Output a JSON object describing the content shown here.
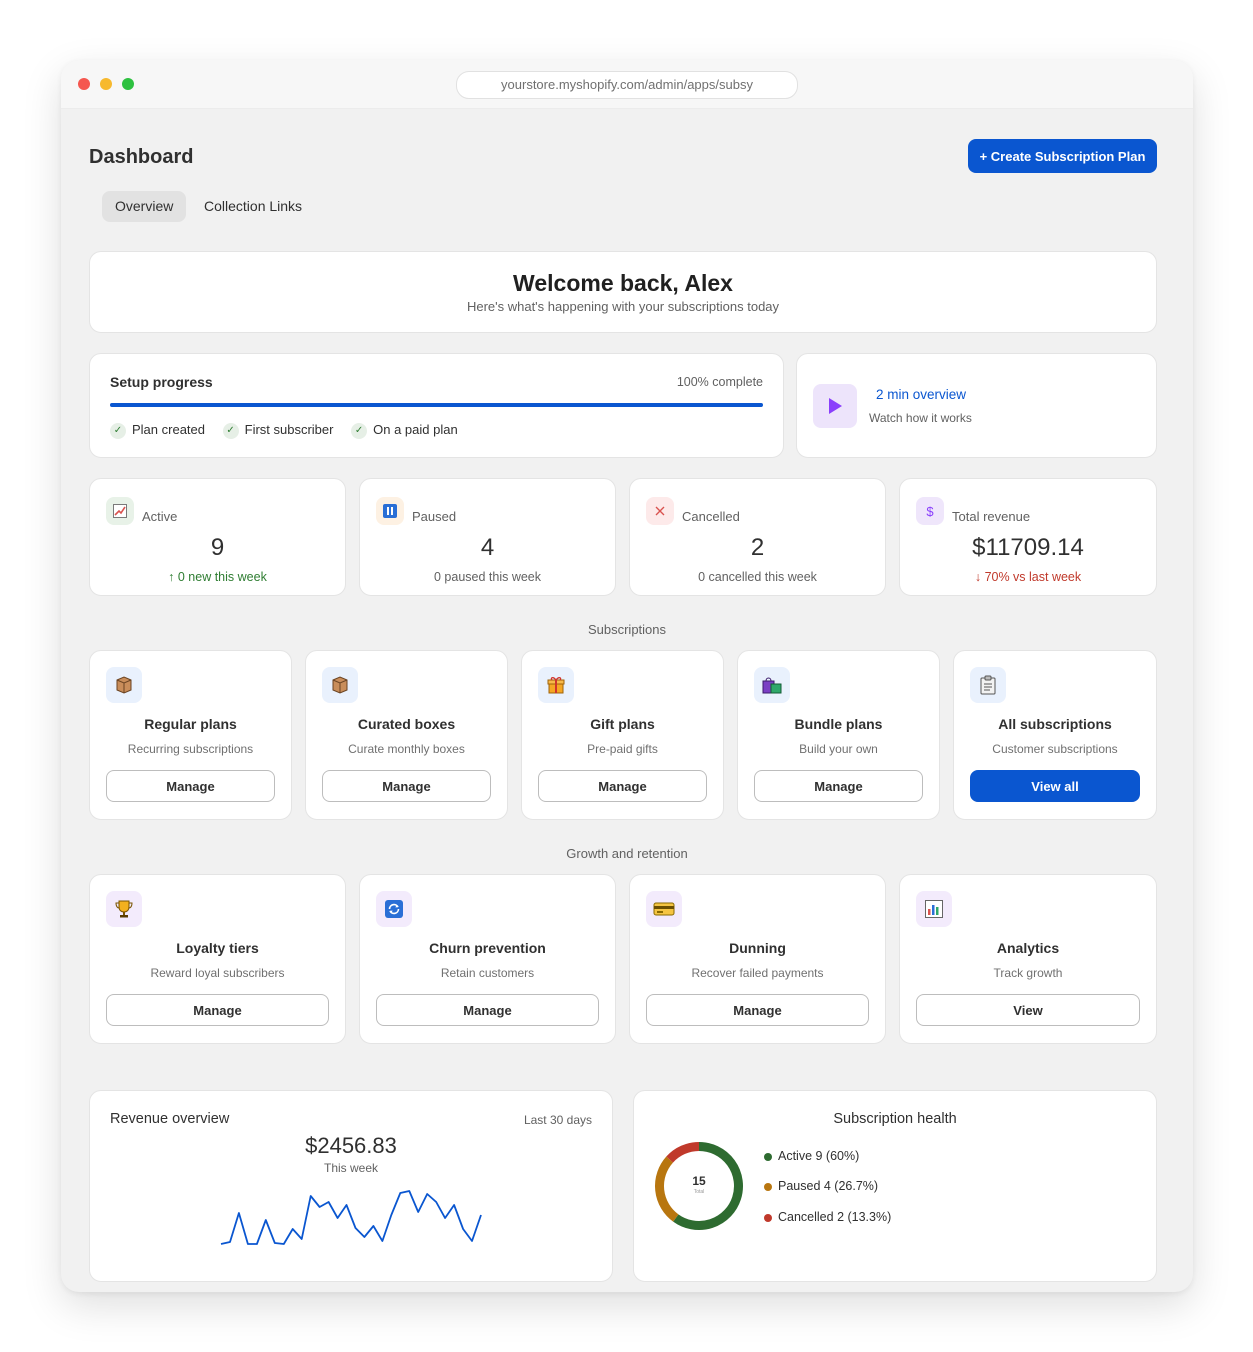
{
  "browser": {
    "url": "yourstore.myshopify.com/admin/apps/subsy"
  },
  "header": {
    "title": "Dashboard",
    "create_button": "+ Create Subscription Plan"
  },
  "tabs": [
    {
      "label": "Overview",
      "active": true
    },
    {
      "label": "Collection Links",
      "active": false
    }
  ],
  "welcome": {
    "title": "Welcome back, Alex",
    "subtitle": "Here's what's happening with your subscriptions today"
  },
  "setup": {
    "title": "Setup progress",
    "status": "100% complete",
    "progress": 1.0,
    "steps": [
      "Plan created",
      "First subscriber",
      "On a paid plan"
    ]
  },
  "video": {
    "title": "2 min overview",
    "subtitle": "Watch how it works"
  },
  "stats": [
    {
      "label": "Active",
      "value": "9",
      "sub": "↑ 0 new this week",
      "sub_color": "#2f7d32"
    },
    {
      "label": "Paused",
      "value": "4",
      "sub": "0 paused this week",
      "sub_color": "#616161"
    },
    {
      "label": "Cancelled",
      "value": "2",
      "sub": "0 cancelled this week",
      "sub_color": "#616161"
    },
    {
      "label": "Total revenue",
      "value": "$11709.14",
      "sub": "↓ 70% vs last week",
      "sub_color": "#c0392b"
    }
  ],
  "subscriptions": {
    "title": "Subscriptions",
    "cards": [
      {
        "title": "Regular plans",
        "sub": "Recurring subscriptions",
        "button": "Manage",
        "icon": "box-icon"
      },
      {
        "title": "Curated boxes",
        "sub": "Curate monthly boxes",
        "button": "Manage",
        "icon": "box-icon"
      },
      {
        "title": "Gift plans",
        "sub": "Pre-paid gifts",
        "button": "Manage",
        "icon": "gift-icon"
      },
      {
        "title": "Bundle plans",
        "sub": "Build your own",
        "button": "Manage",
        "icon": "shopping-bags-icon"
      },
      {
        "title": "All subscriptions",
        "sub": "Customer subscriptions",
        "button": "View all",
        "icon": "clipboard-icon"
      }
    ]
  },
  "growth": {
    "title": "Growth and retention",
    "cards": [
      {
        "title": "Loyalty tiers",
        "sub": "Reward loyal subscribers",
        "button": "Manage",
        "icon": "trophy-icon"
      },
      {
        "title": "Churn prevention",
        "sub": "Retain customers",
        "button": "Manage",
        "icon": "refresh-icon"
      },
      {
        "title": "Dunning",
        "sub": "Recover failed payments",
        "button": "Manage",
        "icon": "credit-card-icon"
      },
      {
        "title": "Analytics",
        "sub": "Track growth",
        "button": "View",
        "icon": "bar-chart-icon"
      }
    ]
  },
  "revenue": {
    "title": "Revenue overview",
    "period": "Last 30 days",
    "amount": "$2456.83",
    "amount_label": "This week"
  },
  "health": {
    "title": "Subscription health",
    "total": "15",
    "total_label": "Total",
    "legend": [
      "Active 9 (60%)",
      "Paused 4 (26.7%)",
      "Cancelled 2 (13.3%)"
    ]
  },
  "colors": {
    "accent": "#0a56d0",
    "active": "#2e6b30",
    "paused": "#b8760f",
    "cancelled": "#c0392b"
  },
  "chart_data": [
    {
      "type": "line",
      "x": [
        1,
        2,
        3,
        4,
        5,
        6,
        7,
        8,
        9,
        10,
        11,
        12,
        13,
        14,
        15,
        16,
        17,
        18,
        19,
        20,
        21,
        22,
        23,
        24,
        25,
        26,
        27,
        28,
        29,
        30
      ],
      "values": [
        5,
        7,
        36,
        5,
        5,
        29,
        6,
        5,
        20,
        10,
        53,
        42,
        47,
        31,
        44,
        21,
        12,
        23,
        8,
        34,
        56,
        58,
        37,
        55,
        47,
        31,
        44,
        20,
        8,
        34
      ],
      "series": [
        {
          "values": [
            5,
            7,
            36,
            5,
            5,
            29,
            6,
            5,
            20,
            10,
            53,
            42,
            47,
            31,
            44,
            21,
            12,
            23,
            8,
            34,
            56,
            58,
            37,
            55,
            47,
            31,
            44,
            20,
            8,
            34
          ]
        }
      ],
      "title": "",
      "xlabel": "",
      "ylabel": "",
      "ylim": [
        0,
        60
      ],
      "grid": false
    },
    {
      "type": "pie",
      "categories": [
        "Active",
        "Paused",
        "Cancelled"
      ],
      "values": [
        9,
        4,
        2
      ],
      "title": "Subscription health"
    }
  ]
}
